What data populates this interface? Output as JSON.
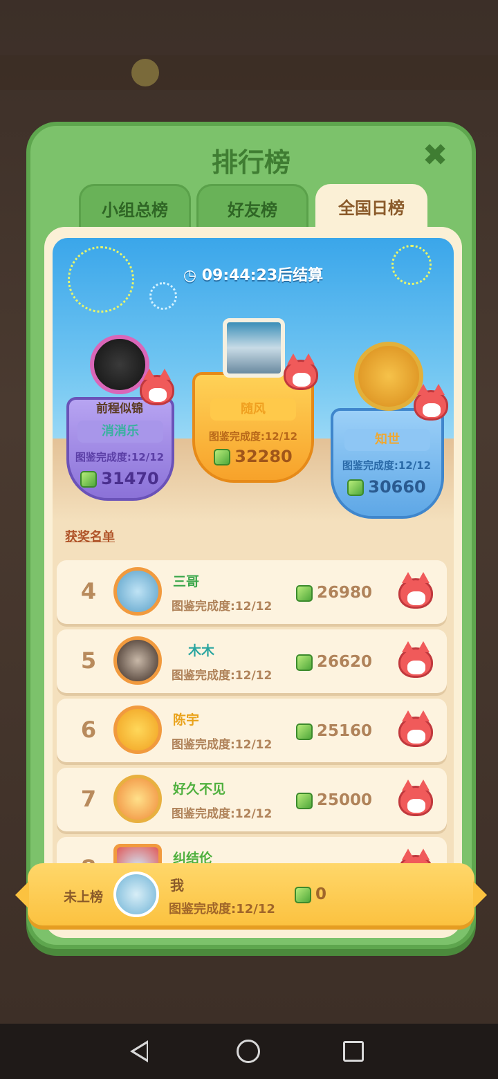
{
  "modal": {
    "title": "排行榜",
    "close_icon": "close-icon",
    "tabs": [
      {
        "label": "小组总榜",
        "active": false
      },
      {
        "label": "好友榜",
        "active": false
      },
      {
        "label": "全国日榜",
        "active": true
      }
    ]
  },
  "timer": {
    "icon": "clock-icon",
    "text": "09:44:23后结算"
  },
  "podium": {
    "first": {
      "name": "随风",
      "progress": "图鉴完成度:12/12",
      "score": "32280"
    },
    "second": {
      "name": "消消乐",
      "badge_text": "前程似锦",
      "progress": "图鉴完成度:12/12",
      "score": "31470"
    },
    "third": {
      "name": "知世",
      "progress": "图鉴完成度:12/12",
      "score": "30660"
    }
  },
  "winners_label": "获奖名单",
  "ranking": [
    {
      "rank": "4",
      "name": "三哥",
      "name_color": "#3aa64a",
      "progress": "图鉴完成度:12/12",
      "score": "26980"
    },
    {
      "rank": "5",
      "name": "木木",
      "name_color": "#2aa5a0",
      "progress": "图鉴完成度:12/12",
      "score": "26620"
    },
    {
      "rank": "6",
      "name": "陈宇",
      "name_color": "#e9a21a",
      "progress": "图鉴完成度:12/12",
      "score": "25160"
    },
    {
      "rank": "7",
      "name": "好久不见",
      "name_color": "#4fb03e",
      "progress": "图鉴完成度:12/12",
      "score": "25000"
    },
    {
      "rank": "8",
      "name": "纠结伦",
      "name_color": "#4fb03e",
      "progress": "",
      "score": ""
    }
  ],
  "my_entry": {
    "status": "未上榜",
    "name": "我",
    "progress": "图鉴完成度:12/12",
    "score": "0"
  },
  "navbar": {
    "back": "back-icon",
    "home": "home-icon",
    "recents": "recents-icon"
  },
  "colors": {
    "modal_green": "#7cc26b",
    "panel_cream": "#fbf0d6",
    "gold": "#fbc240",
    "fox_red": "#f05a5a"
  }
}
